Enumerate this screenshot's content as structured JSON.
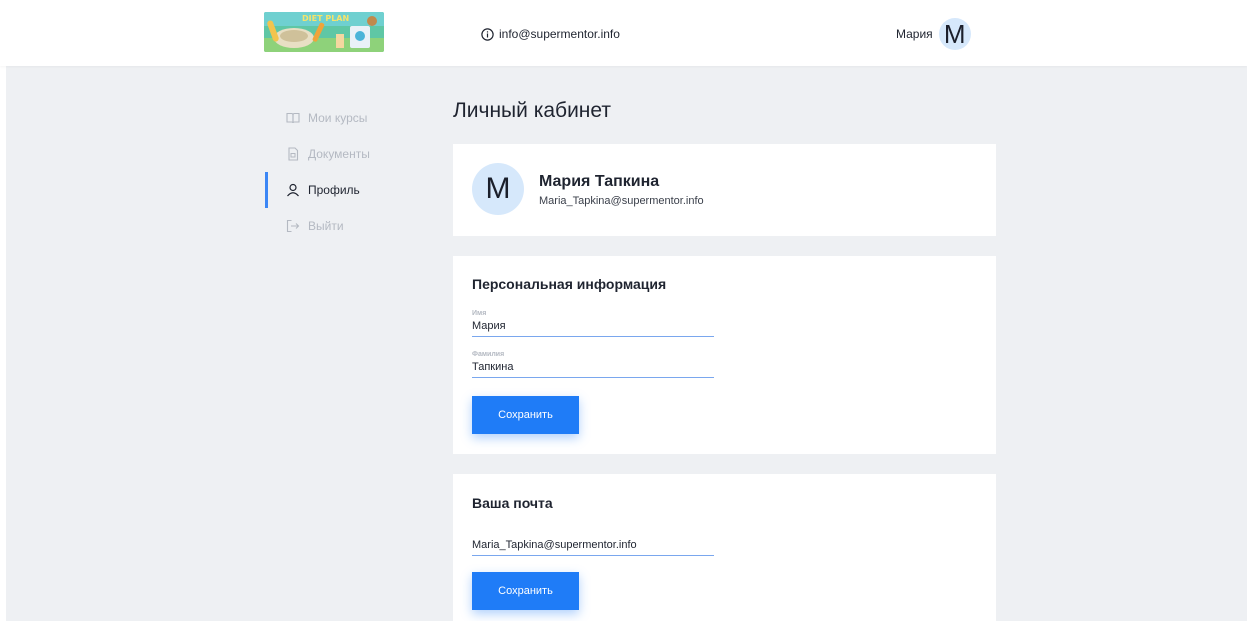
{
  "header": {
    "logo_text": "DIET PLAN",
    "contact_email": "info@supermentor.info",
    "user_name": "Мария",
    "avatar_letter": "M"
  },
  "sidebar": {
    "items": [
      {
        "label": "Мои курсы",
        "icon": "book-icon",
        "active": false
      },
      {
        "label": "Документы",
        "icon": "document-icon",
        "active": false
      },
      {
        "label": "Профиль",
        "icon": "user-icon",
        "active": true
      },
      {
        "label": "Выйти",
        "icon": "logout-icon",
        "active": false
      }
    ]
  },
  "page": {
    "title": "Личный кабинет"
  },
  "profile": {
    "avatar_letter": "M",
    "full_name": "Мария Тапкина",
    "email": "Maria_Tapkina@supermentor.info"
  },
  "personal": {
    "title": "Персональная информация",
    "first_name_label": "Имя",
    "first_name_value": "Мария",
    "last_name_label": "Фамилия",
    "last_name_value": "Тапкина",
    "save_label": "Сохранить"
  },
  "email_section": {
    "title": "Ваша почта",
    "email_value": "Maria_Tapkina@supermentor.info",
    "save_label": "Сохранить"
  },
  "colors": {
    "accent": "#1f7cf7",
    "active_indicator": "#3b86f5",
    "avatar_bg": "#d6e8fb",
    "page_bg": "#eef0f3"
  }
}
